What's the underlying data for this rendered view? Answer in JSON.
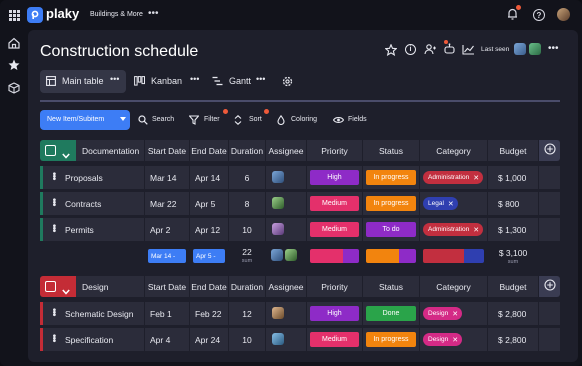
{
  "app": {
    "logo_text": "plaky",
    "workspace": "Buildings & More"
  },
  "board": {
    "title": "Construction schedule",
    "last_seen_label": "Last seen"
  },
  "views": [
    {
      "label": "Main table"
    },
    {
      "label": "Kanban"
    },
    {
      "label": "Gantt"
    }
  ],
  "toolbar": {
    "new_item": "New Item/Subitem",
    "search": "Search",
    "filter": "Filter",
    "sort": "Sort",
    "coloring": "Coloring",
    "fields": "Fields"
  },
  "columns": [
    "Start Date",
    "End Date",
    "Duration",
    "Assignee",
    "Priority",
    "Status",
    "Category",
    "Budget"
  ],
  "groups": [
    {
      "name": "Documentation",
      "color": "#1f7a5e",
      "items": [
        {
          "name": "Proposals",
          "start": "Mar 14",
          "end": "Apr 14",
          "duration": "6",
          "priority": "High",
          "priority_color": "#8e2bc7",
          "status": "In progress",
          "status_color": "#f2840e",
          "category": "Administration",
          "category_color": "#c22f3f",
          "budget": "$ 1,000"
        },
        {
          "name": "Contracts",
          "start": "Mar 22",
          "end": "Apr 5",
          "duration": "8",
          "priority": "Medium",
          "priority_color": "#e4306b",
          "status": "In progress",
          "status_color": "#f2840e",
          "category": "Legal",
          "category_color": "#2f3fb0",
          "budget": "$ 800"
        },
        {
          "name": "Permits",
          "start": "Apr 2",
          "end": "Apr 12",
          "duration": "10",
          "priority": "Medium",
          "priority_color": "#e4306b",
          "status": "To do",
          "status_color": "#8e2bc7",
          "category": "Administration",
          "category_color": "#c22f3f",
          "budget": "$ 1,300"
        }
      ],
      "summary": {
        "start": "Mar 14 -",
        "end": "Apr 5 -",
        "duration": "22",
        "duration_label": "sum",
        "budget": "$ 3,100",
        "budget_label": "sum"
      }
    },
    {
      "name": "Design",
      "color": "#c42c36",
      "items": [
        {
          "name": "Schematic Design",
          "start": "Feb 1",
          "end": "Feb 22",
          "duration": "12",
          "priority": "High",
          "priority_color": "#8e2bc7",
          "status": "Done",
          "status_color": "#2aa44a",
          "category": "Design",
          "category_color": "#d42a86",
          "budget": "$ 2,800"
        },
        {
          "name": "Specification",
          "start": "Apr 4",
          "end": "Apr 24",
          "duration": "10",
          "priority": "Medium",
          "priority_color": "#e4306b",
          "status": "In progress",
          "status_color": "#f2840e",
          "category": "Design",
          "category_color": "#d42a86",
          "budget": "$ 2,800"
        }
      ]
    }
  ],
  "colors": {
    "accent": "#3d7df5",
    "panel": "#1e1f2b",
    "row": "#2b2c3a",
    "badge": "#ef5a3a"
  }
}
